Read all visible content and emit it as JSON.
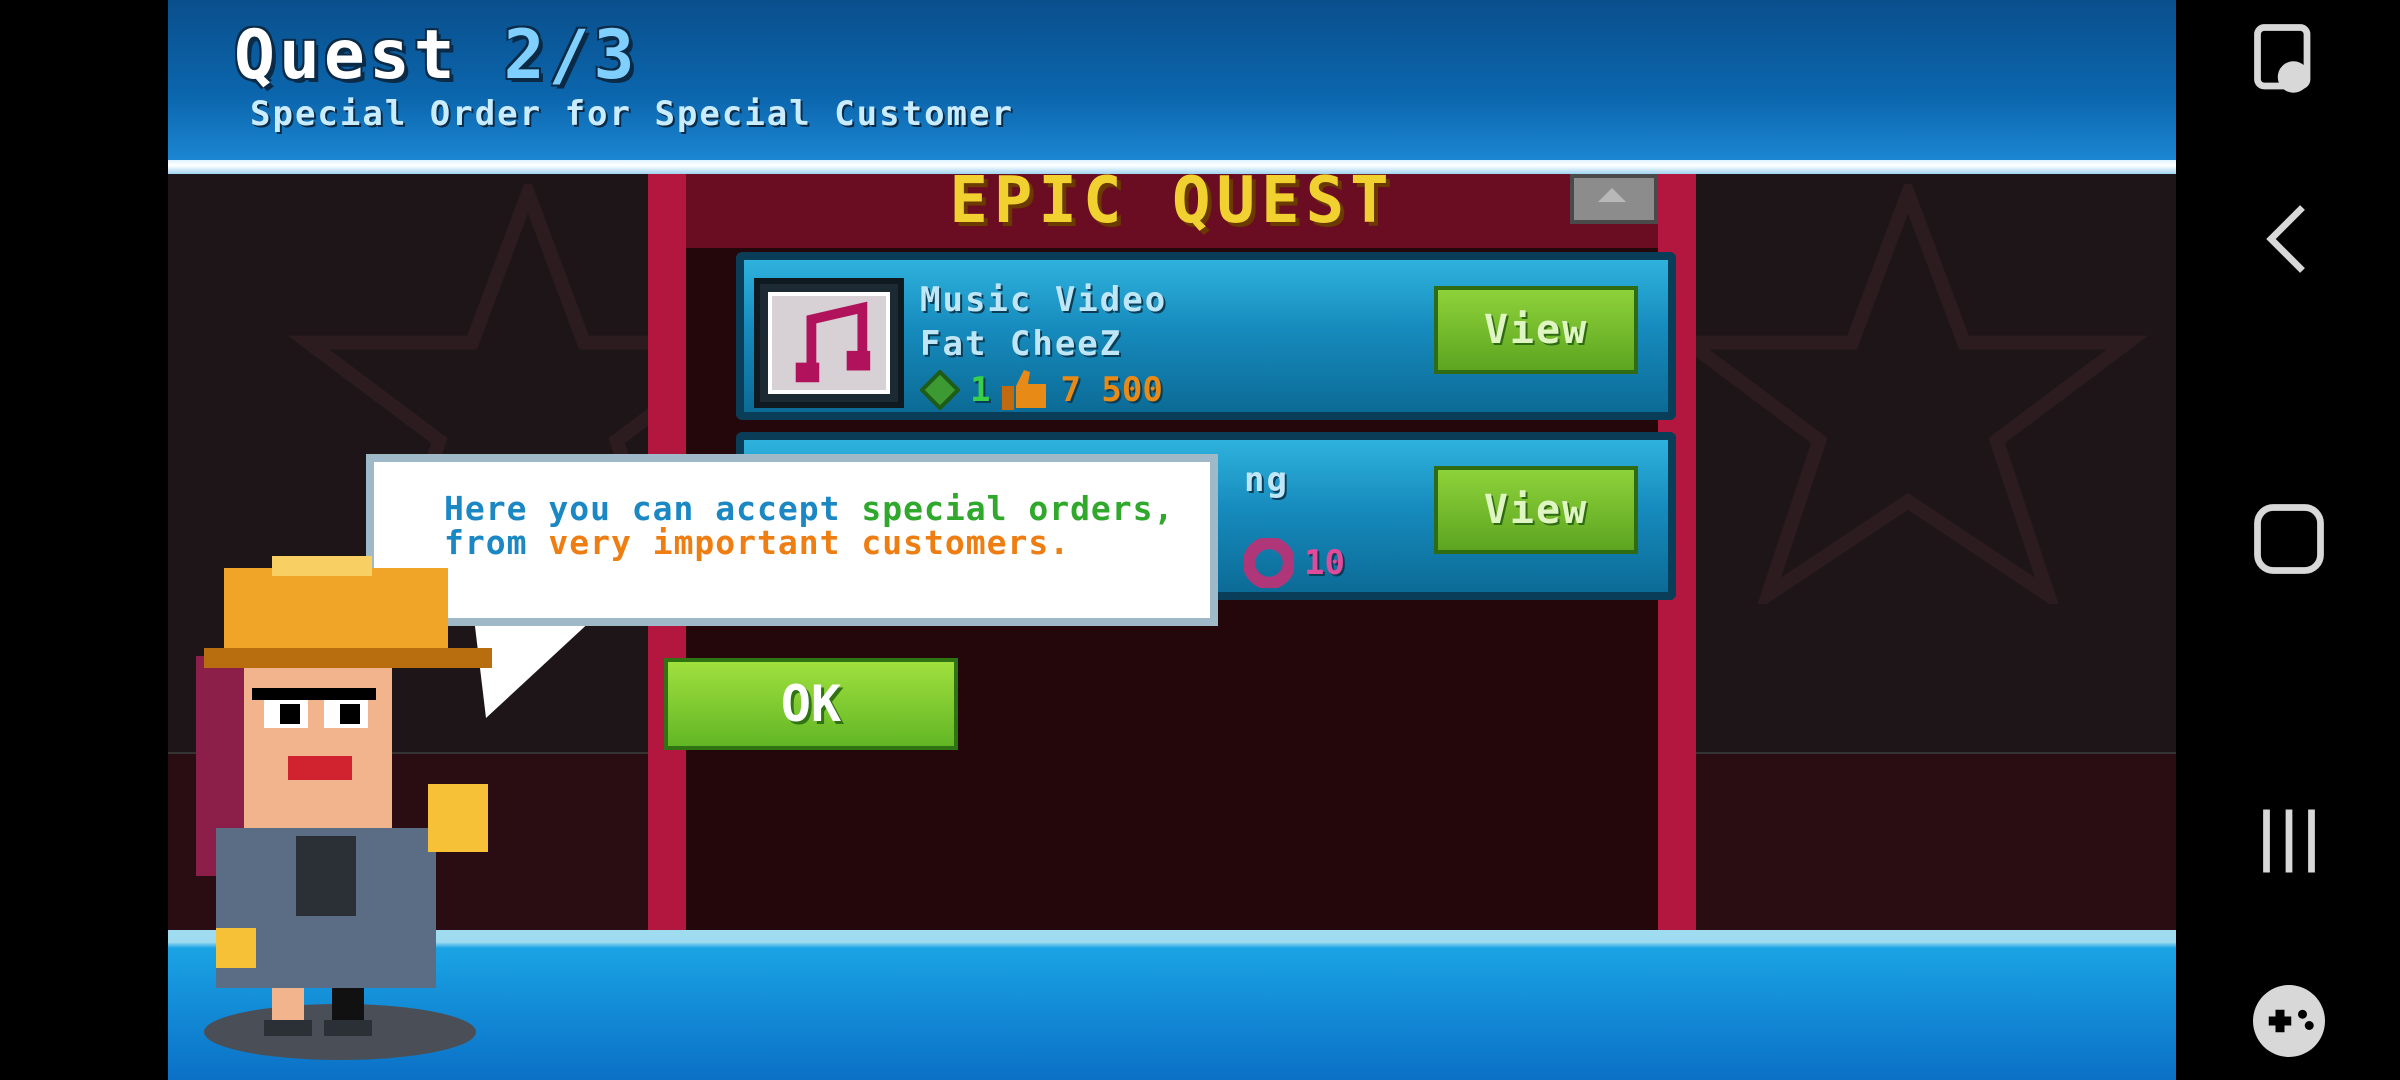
{
  "header": {
    "quest_label": "Quest",
    "quest_progress": "2/3",
    "subtitle": "Special Order for Special Customer"
  },
  "panel": {
    "title": "EPIC QUEST",
    "quests": [
      {
        "name": "Music Video",
        "client": "Fat CheeZ",
        "reward_cash": "1",
        "reward_likes": "7 500",
        "view_label": "View"
      },
      {
        "name": "ng",
        "reward_fans": "10",
        "view_label": "View"
      }
    ]
  },
  "tutorial": {
    "part1": "Here you can accept",
    "part2": "special",
    "part3": "orders,",
    "part4": "from",
    "part5": "very important",
    "part6": "customers.",
    "ok_label": "OK"
  },
  "icons": {
    "thumb_icon": "music-note-icon",
    "cash_icon": "cash-icon",
    "likes_icon": "thumbs-up-icon",
    "fans_icon": "donut-icon"
  },
  "colors": {
    "accent_blue": "#1b88c4",
    "accent_green": "#2fa82c",
    "accent_orange": "#ee7d12",
    "panel_red": "#b3163e",
    "title_yellow": "#f1d130"
  }
}
